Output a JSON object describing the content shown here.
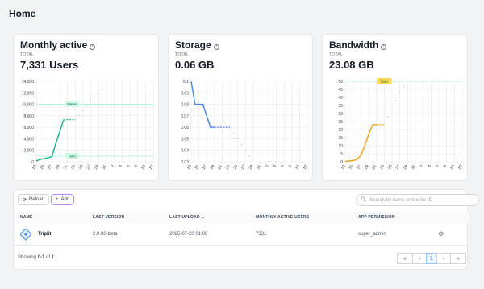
{
  "page": {
    "title": "Home"
  },
  "cards": [
    {
      "title": "Monthly active",
      "total_label": "TOTAL",
      "total_value": "7,331 Users",
      "color": "#10b981",
      "chart_data": {
        "type": "line",
        "title": "",
        "x_ticks": [
          "13",
          "15",
          "17",
          "19",
          "21",
          "23",
          "25",
          "27",
          "29",
          "31",
          "2",
          "4",
          "6",
          "8",
          "10",
          "12"
        ],
        "y_ticks": [
          "0",
          "2,000",
          "4,000",
          "6,000",
          "8,000",
          "10,000",
          "12,000",
          "14,000"
        ],
        "ylim": [
          0,
          14000
        ],
        "grid": true,
        "series": [
          {
            "x": [
              13,
              14,
              15,
              16,
              17,
              18,
              19,
              20,
              21,
              22,
              23
            ],
            "y": [
              150,
              400,
              550,
              700,
              900,
              3200,
              5200,
              7300,
              7350,
              7320,
              7331
            ],
            "dashed_from": 20
          },
          {
            "x": [
              23,
              24,
              25,
              26,
              27,
              28,
              29,
              30
            ],
            "y": [
              7331,
              8000,
              8900,
              9800,
              10600,
              11300,
              12000,
              12600
            ],
            "projection": true
          }
        ],
        "reference_lines": [
          {
            "label": "Maker",
            "y": 10000
          },
          {
            "label": "Solo",
            "y": 1000
          }
        ]
      }
    },
    {
      "title": "Storage",
      "total_label": "TOTAL",
      "total_value": "0.06 GB",
      "color": "#3b82f6",
      "chart_data": {
        "type": "line",
        "title": "",
        "x_ticks": [
          "13",
          "15",
          "17",
          "19",
          "21",
          "23",
          "25",
          "27",
          "29",
          "31",
          "2",
          "4",
          "6",
          "8",
          "10",
          "12"
        ],
        "y_ticks": [
          "0.03",
          "0.04",
          "0.05",
          "0.06",
          "0.07",
          "0.08",
          "0.09",
          "0.1"
        ],
        "ylim": [
          0.03,
          0.1
        ],
        "grid": true,
        "series": [
          {
            "x": [
              13,
              14,
              15,
              16,
              17,
              18,
              19,
              20,
              21,
              22,
              23
            ],
            "y": [
              0.1,
              0.08,
              0.08,
              0.08,
              0.07,
              0.06,
              0.06,
              0.06,
              0.06,
              0.06,
              0.06
            ],
            "dashed_from": 19
          },
          {
            "x": [
              23,
              24,
              25,
              26,
              27,
              28
            ],
            "y": [
              0.06,
              0.055,
              0.05,
              0.045,
              0.04,
              0.035
            ],
            "projection": true
          }
        ],
        "reference_lines": []
      }
    },
    {
      "title": "Bandwidth",
      "total_label": "TOTAL",
      "total_value": "23.08 GB",
      "color": "#f59e0b",
      "chart_data": {
        "type": "line",
        "title": "",
        "x_ticks": [
          "13",
          "15",
          "17",
          "19",
          "21",
          "23",
          "25",
          "27",
          "29",
          "31",
          "2",
          "4",
          "6",
          "8",
          "10",
          "12"
        ],
        "y_ticks": [
          "0",
          "5",
          "10",
          "15",
          "20",
          "25",
          "30",
          "35",
          "40",
          "45",
          "50"
        ],
        "ylim": [
          0,
          50
        ],
        "grid": true,
        "series": [
          {
            "x": [
              13,
              14,
              15,
              16,
              17,
              18,
              19,
              20,
              21,
              22,
              23
            ],
            "y": [
              0.3,
              0.5,
              0.8,
              1.5,
              4,
              10,
              17,
              23,
              23.08,
              23.08,
              23.08
            ],
            "dashed_from": 21
          },
          {
            "x": [
              23,
              24,
              25,
              26,
              27,
              28
            ],
            "y": [
              23.08,
              28,
              33,
              38,
              43,
              47
            ],
            "projection": true
          }
        ],
        "reference_lines": [
          {
            "label": "Solo",
            "y": 50
          }
        ]
      }
    }
  ],
  "toolbar": {
    "reload_label": "Reload",
    "add_label": "Add",
    "search_placeholder": "Search by name or bundle ID"
  },
  "table": {
    "headers": [
      "NAME",
      "LAST VERSION",
      "LAST UPLOAD",
      "MONTHLY ACTIVE USERS",
      "APP PERMISSION"
    ],
    "rows": [
      {
        "name": "Triplit",
        "version": "2.0.30-beta",
        "upload": "2025-07-20 01:00",
        "mau": "7331",
        "permission": "super_admin"
      }
    ]
  },
  "footer": {
    "showing_prefix": "Showing",
    "showing_range": "0-1",
    "showing_of": "of",
    "showing_total": "1",
    "pager": [
      "«",
      "‹",
      "1",
      "›",
      "»"
    ]
  }
}
